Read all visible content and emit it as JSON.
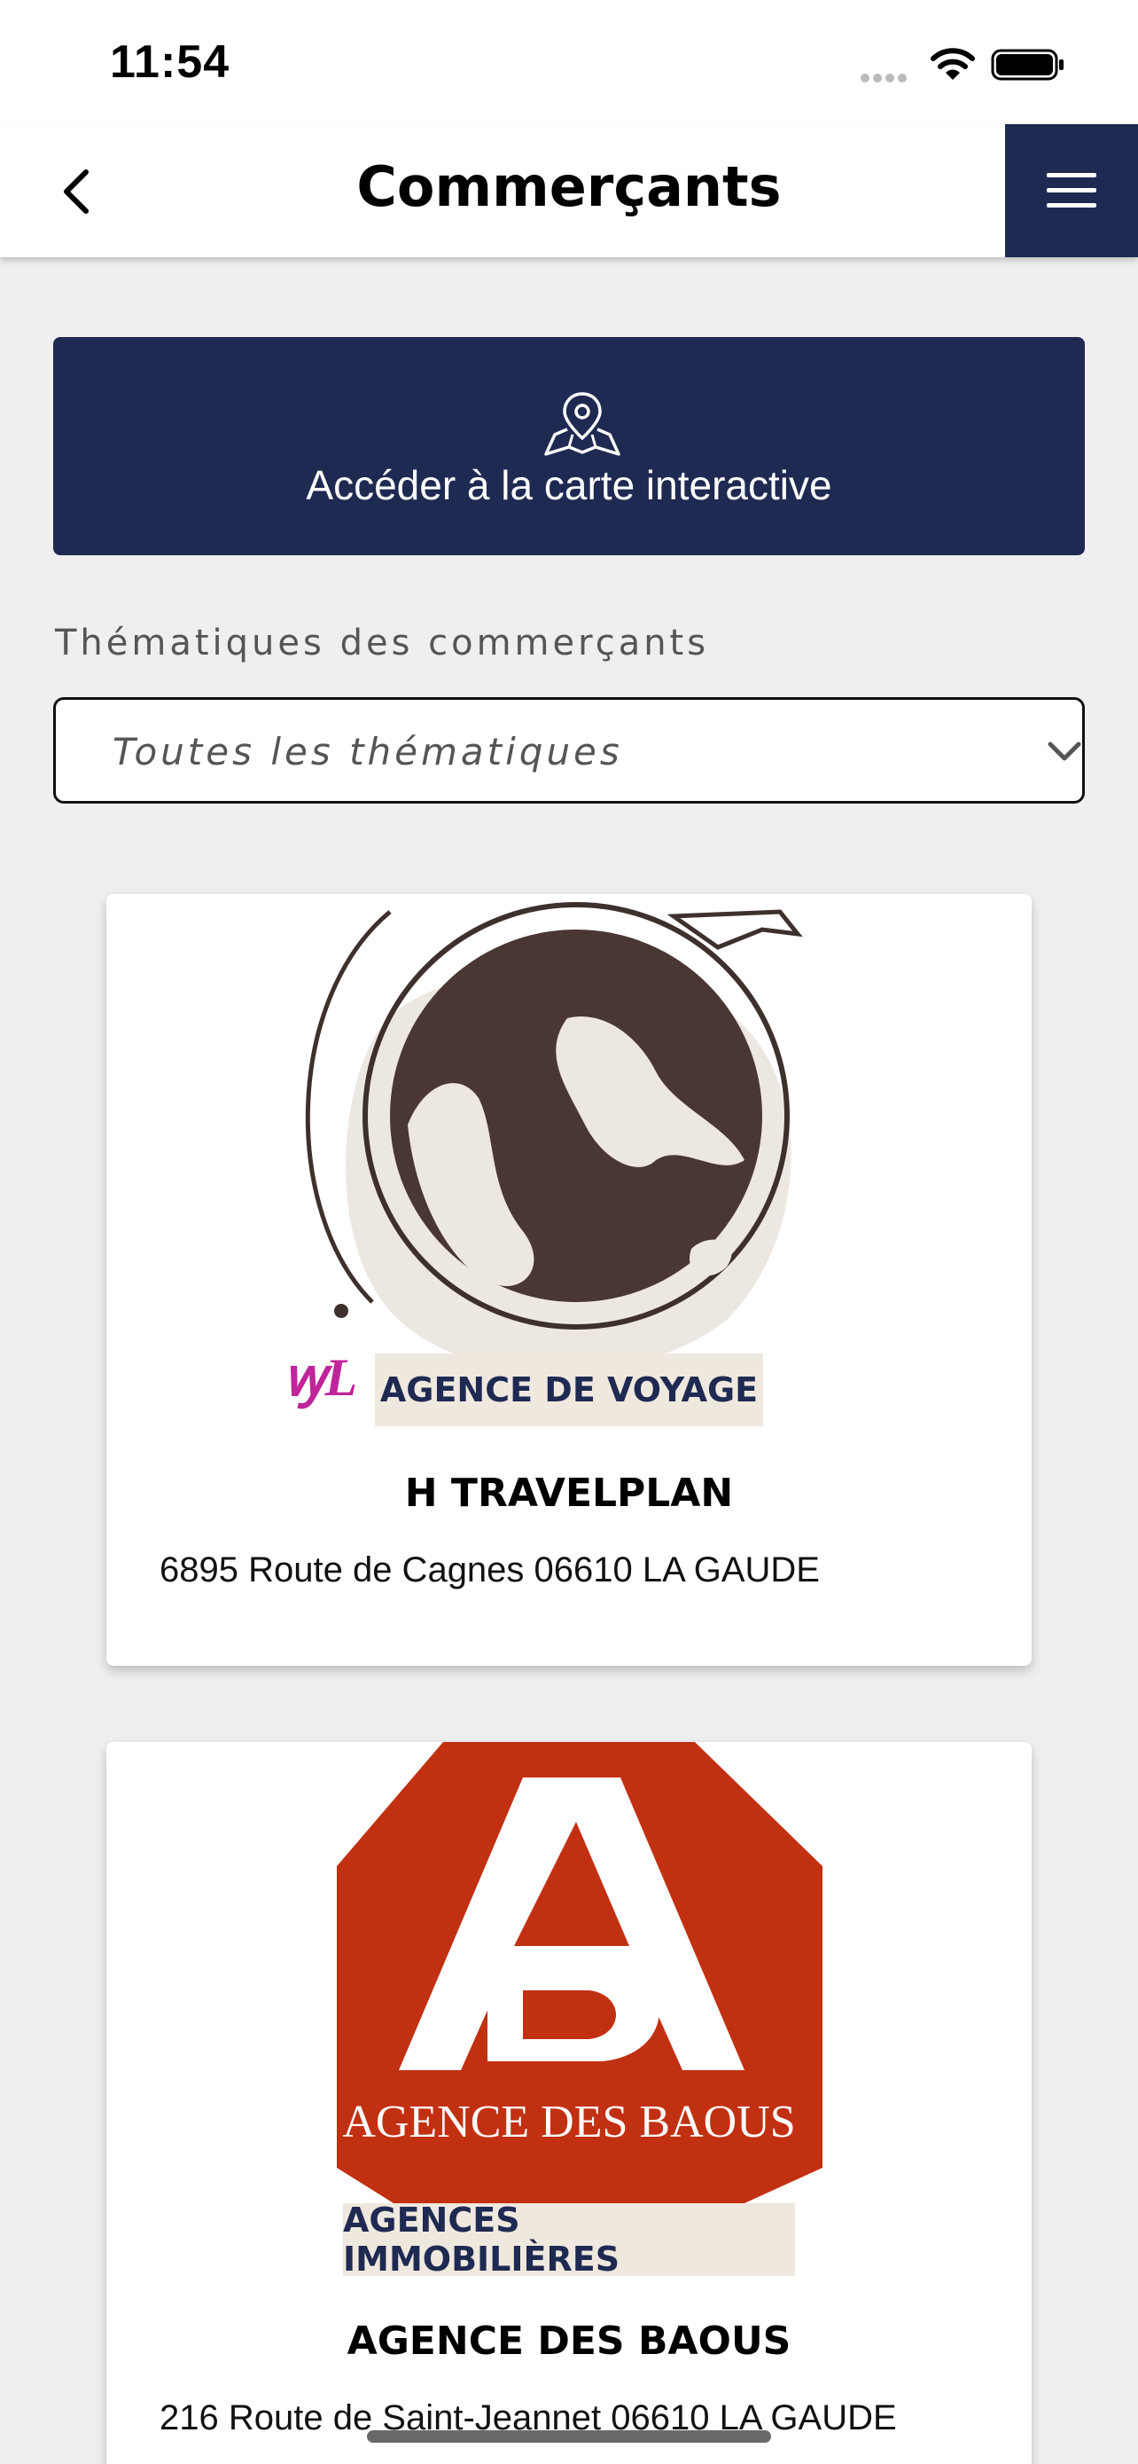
{
  "status_bar": {
    "time": "11:54"
  },
  "header": {
    "title": "Commerçants"
  },
  "map_button": {
    "label": "Accéder à la carte interactive"
  },
  "filter": {
    "label": "Thématiques des commerçants",
    "selected": "Toutes les thématiques"
  },
  "merchants": [
    {
      "category": "AGENCE DE VOYAGE",
      "name": "H TRAVELPLAN",
      "address": "6895 Route de Cagnes 06610 LA GAUDE"
    },
    {
      "category": "AGENCES IMMOBILIÈRES",
      "name": "AGENCE DES BAOUS",
      "address": "216 Route de Saint-Jeannet 06610 LA GAUDE",
      "logo_text": "AGENCE DES BAOUS"
    }
  ],
  "colors": {
    "navy": "#1f2a52",
    "badge_bg": "#efe8de",
    "logo_red": "#c23012",
    "page_bg": "#efefef"
  },
  "icons": {
    "back": "chevron-left-icon",
    "menu": "hamburger-menu-icon",
    "map": "map-pin-icon",
    "dropdown": "chevron-down-icon"
  }
}
